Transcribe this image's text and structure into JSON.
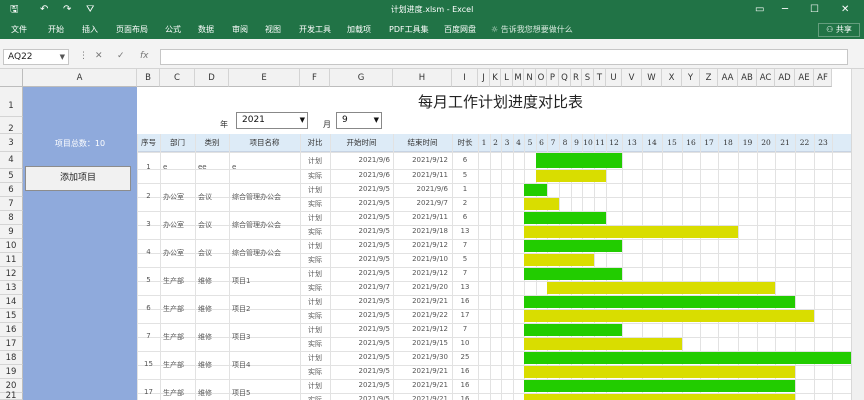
{
  "titlebar": {
    "save_icon": "save-icon",
    "undo_icon": "undo-icon",
    "redo_icon": "redo-icon",
    "filter_icon": "filter-icon",
    "title": "计划进度.xlsm - Excel",
    "restore_icon": "restore-icon",
    "minimize_icon": "minimize-icon",
    "maximize_icon": "maximize-icon",
    "close_icon": "close-icon"
  },
  "ribbon": {
    "tabs": [
      "文件",
      "开始",
      "插入",
      "页面布局",
      "公式",
      "数据",
      "审阅",
      "视图",
      "开发工具",
      "加载项",
      "PDF工具集",
      "百度网盘"
    ],
    "search": "告诉我您想要做什么",
    "share": "共享"
  },
  "formula": {
    "namebox": "AQ22",
    "cancel": "✕",
    "enter": "✓",
    "fx": "fx",
    "value": ""
  },
  "columns": [
    "A",
    "B",
    "C",
    "D",
    "E",
    "F",
    "G",
    "H",
    "I",
    "J",
    "K",
    "L",
    "M",
    "N",
    "O",
    "P",
    "Q",
    "R",
    "S",
    "T",
    "U",
    "V",
    "W",
    "X",
    "Y",
    "Z",
    "AA",
    "AB",
    "AC",
    "AD",
    "AE",
    "AF"
  ],
  "rows": [
    "1",
    "2",
    "3",
    "4",
    "5",
    "6",
    "7",
    "8",
    "9",
    "10",
    "11",
    "12",
    "13",
    "14",
    "15",
    "16",
    "17",
    "18",
    "19",
    "20",
    "21"
  ],
  "sheet": {
    "title": "每月工作计划进度对比表",
    "year_label": "年",
    "year_value": "2021",
    "month_label": "月",
    "month_value": "9",
    "total_label": "项目总数：10",
    "add_button": "添加项目",
    "headers": [
      "序号",
      "部门",
      "类别",
      "项目名称",
      "对比",
      "开始时间",
      "结束时间",
      "时长"
    ],
    "days": [
      "1",
      "2",
      "3",
      "4",
      "5",
      "6",
      "7",
      "8",
      "9",
      "10",
      "11",
      "12",
      "13",
      "14",
      "15",
      "16",
      "17",
      "18",
      "19",
      "20",
      "21",
      "22",
      "23"
    ],
    "projects": [
      {
        "seq": "1",
        "dept": "e",
        "cat": "ee",
        "name": "e"
      },
      {
        "seq": "2",
        "dept": "办公室",
        "cat": "会议",
        "name": "综合管理办公会"
      },
      {
        "seq": "3",
        "dept": "办公室",
        "cat": "会议",
        "name": "综合管理办公会"
      },
      {
        "seq": "4",
        "dept": "办公室",
        "cat": "会议",
        "name": "综合管理办公会"
      },
      {
        "seq": "5",
        "dept": "生产部",
        "cat": "维修",
        "name": "项目1"
      },
      {
        "seq": "6",
        "dept": "生产部",
        "cat": "维修",
        "name": "项目2"
      },
      {
        "seq": "7",
        "dept": "生产部",
        "cat": "维修",
        "name": "项目3"
      },
      {
        "seq": "15",
        "dept": "生产部",
        "cat": "维修",
        "name": "项目4"
      },
      {
        "seq": "17",
        "dept": "生产部",
        "cat": "维修",
        "name": "项目5"
      }
    ],
    "lines": [
      {
        "cmp": "计划",
        "start": "2021/9/6",
        "end": "2021/9/12",
        "dur": "6",
        "s": 6,
        "e": 12,
        "kind": "plan"
      },
      {
        "cmp": "实际",
        "start": "2021/9/6",
        "end": "2021/9/11",
        "dur": "5",
        "s": 6,
        "e": 11,
        "kind": "actual"
      },
      {
        "cmp": "计划",
        "start": "2021/9/5",
        "end": "2021/9/6",
        "dur": "1",
        "s": 5,
        "e": 6,
        "kind": "plan"
      },
      {
        "cmp": "实际",
        "start": "2021/9/5",
        "end": "2021/9/7",
        "dur": "2",
        "s": 5,
        "e": 7,
        "kind": "actual"
      },
      {
        "cmp": "计划",
        "start": "2021/9/5",
        "end": "2021/9/11",
        "dur": "6",
        "s": 5,
        "e": 11,
        "kind": "plan"
      },
      {
        "cmp": "实际",
        "start": "2021/9/5",
        "end": "2021/9/18",
        "dur": "13",
        "s": 5,
        "e": 18,
        "kind": "actual"
      },
      {
        "cmp": "计划",
        "start": "2021/9/5",
        "end": "2021/9/12",
        "dur": "7",
        "s": 5,
        "e": 12,
        "kind": "plan"
      },
      {
        "cmp": "实际",
        "start": "2021/9/5",
        "end": "2021/9/10",
        "dur": "5",
        "s": 5,
        "e": 10,
        "kind": "actual"
      },
      {
        "cmp": "计划",
        "start": "2021/9/5",
        "end": "2021/9/12",
        "dur": "7",
        "s": 5,
        "e": 12,
        "kind": "plan"
      },
      {
        "cmp": "实际",
        "start": "2021/9/7",
        "end": "2021/9/20",
        "dur": "13",
        "s": 7,
        "e": 20,
        "kind": "actual"
      },
      {
        "cmp": "计划",
        "start": "2021/9/5",
        "end": "2021/9/21",
        "dur": "16",
        "s": 5,
        "e": 21,
        "kind": "plan"
      },
      {
        "cmp": "实际",
        "start": "2021/9/5",
        "end": "2021/9/22",
        "dur": "17",
        "s": 5,
        "e": 22,
        "kind": "actual"
      },
      {
        "cmp": "计划",
        "start": "2021/9/5",
        "end": "2021/9/12",
        "dur": "7",
        "s": 5,
        "e": 12,
        "kind": "plan"
      },
      {
        "cmp": "实际",
        "start": "2021/9/5",
        "end": "2021/9/15",
        "dur": "10",
        "s": 5,
        "e": 15,
        "kind": "actual"
      },
      {
        "cmp": "计划",
        "start": "2021/9/5",
        "end": "2021/9/30",
        "dur": "25",
        "s": 5,
        "e": 30,
        "kind": "plan"
      },
      {
        "cmp": "实际",
        "start": "2021/9/5",
        "end": "2021/9/21",
        "dur": "16",
        "s": 5,
        "e": 21,
        "kind": "actual"
      },
      {
        "cmp": "计划",
        "start": "2021/9/5",
        "end": "2021/9/21",
        "dur": "16",
        "s": 5,
        "e": 21,
        "kind": "plan"
      },
      {
        "cmp": "实际",
        "start": "2021/9/5",
        "end": "2021/9/21",
        "dur": "16",
        "s": 5,
        "e": 21,
        "kind": "actual"
      }
    ]
  },
  "colors": {
    "plan": "#22cc00",
    "actual": "#d9dd00",
    "header_strip": "#ddebf7",
    "side_panel": "#8faadc",
    "excel_green": "#217346"
  }
}
